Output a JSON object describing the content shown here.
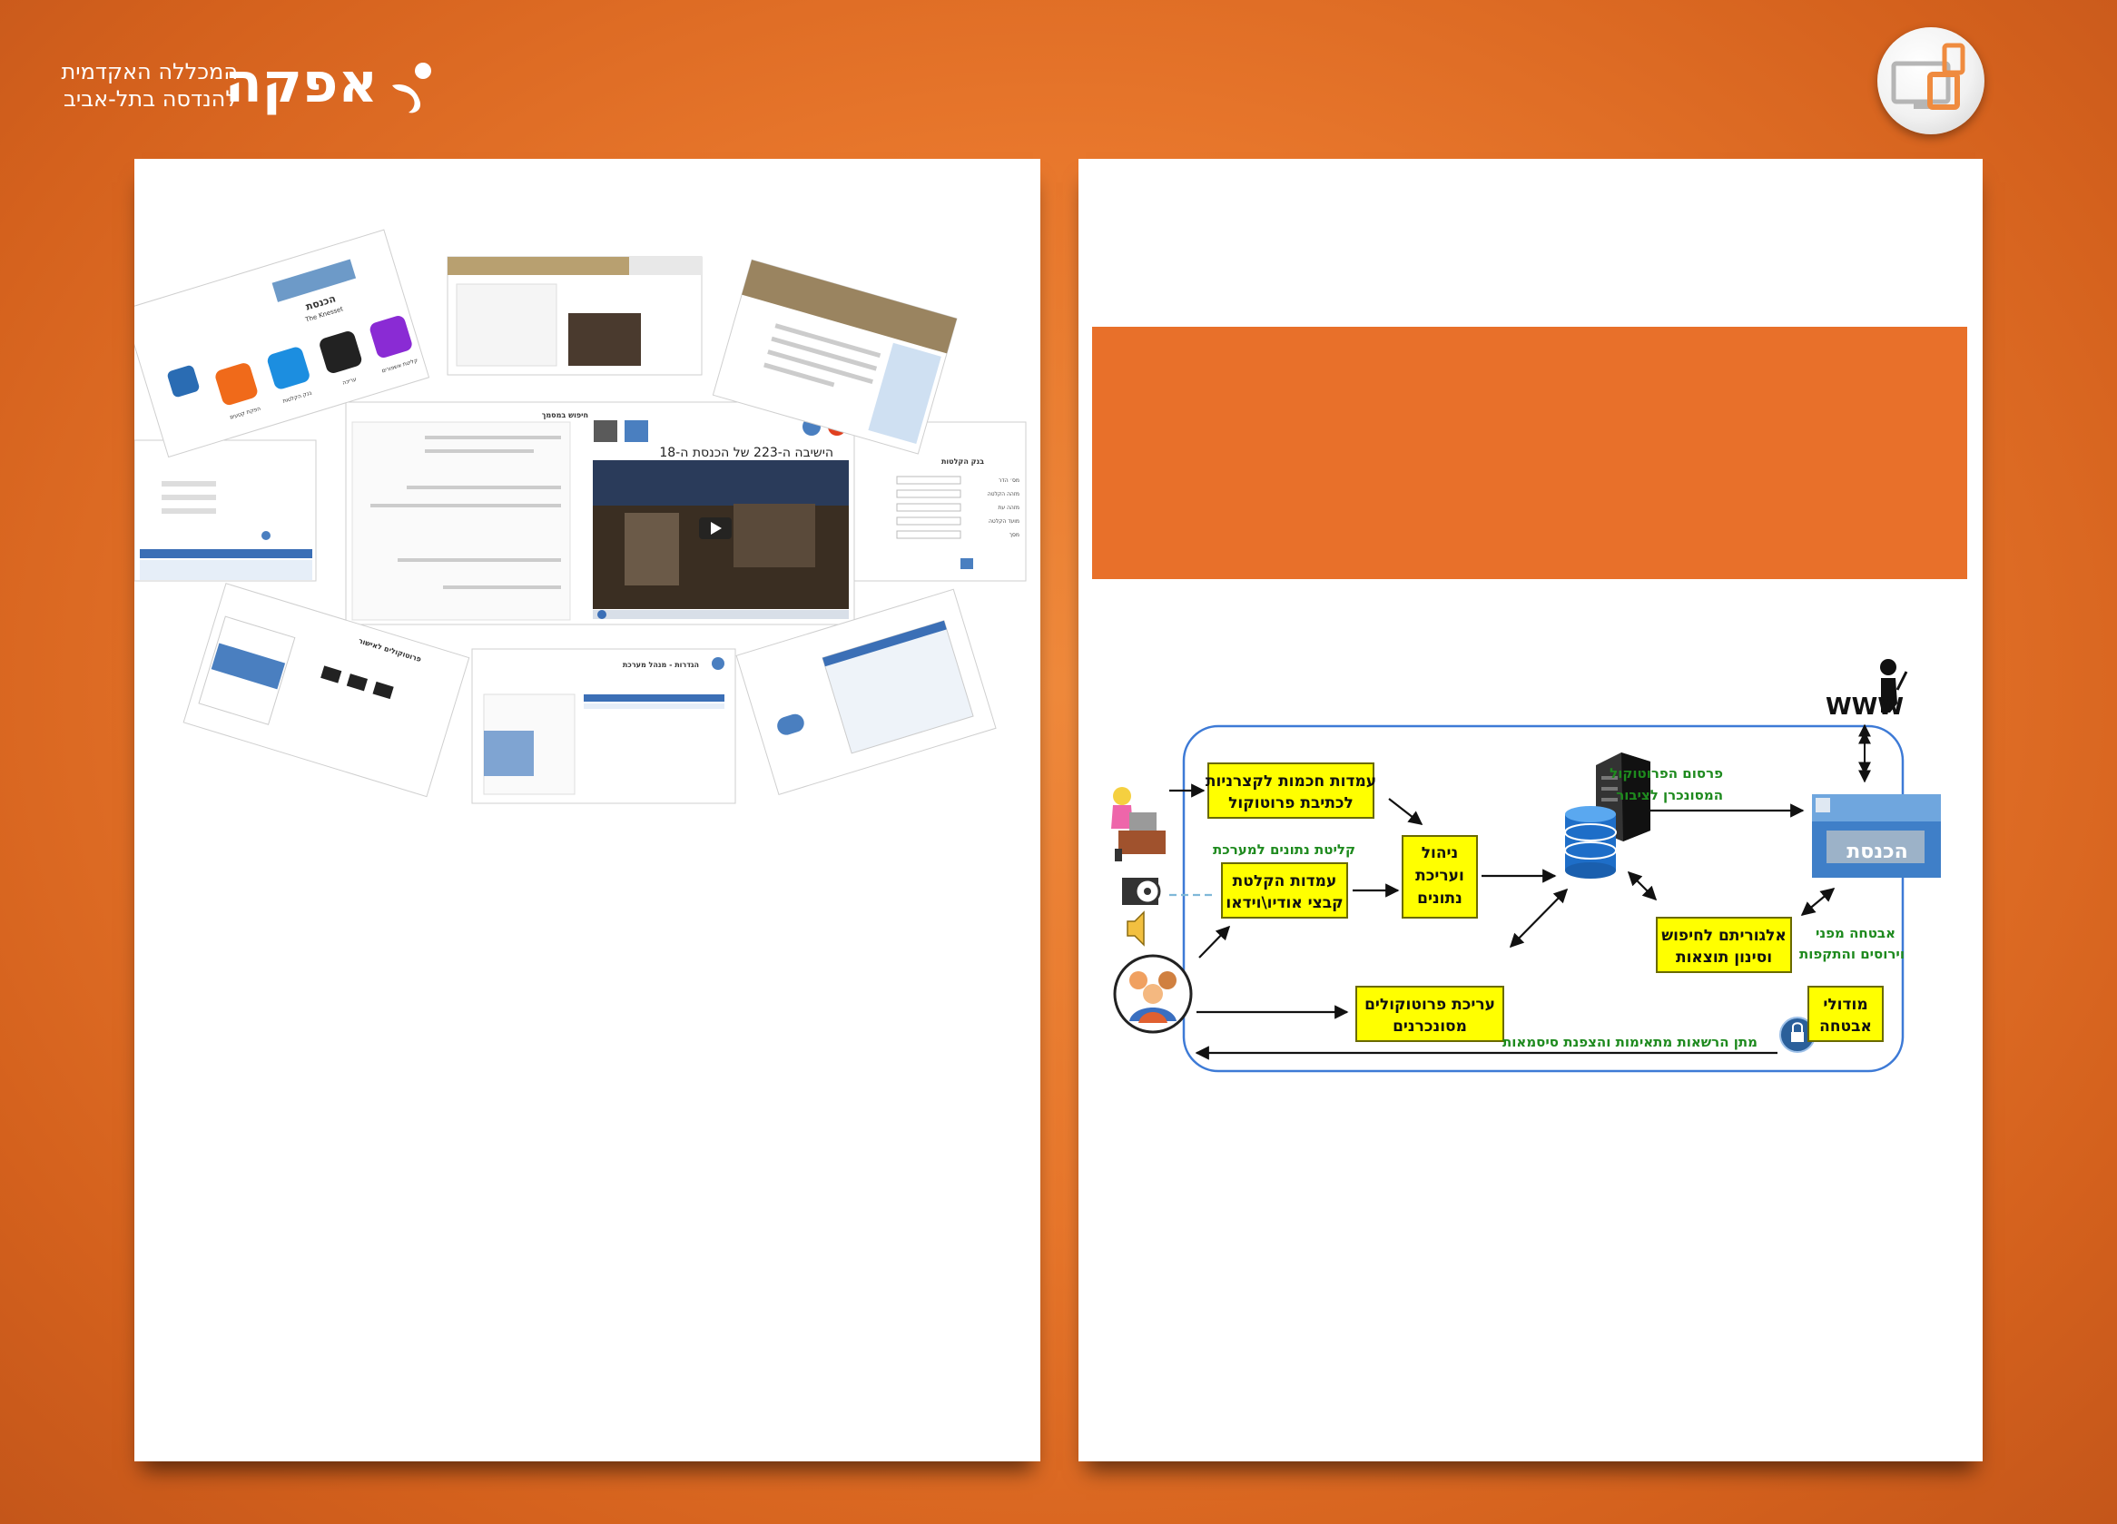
{
  "logo": {
    "name": "אפקה",
    "subtitle_line1": "המכללה האקדמית",
    "subtitle_line2": "להנדסה בתל-אביב"
  },
  "collage": {
    "video_title": "הישיבה ה-223 של הכנסת ה-18",
    "portal_title": "הכנסת",
    "portal_title_en": "The Knesset",
    "app_labels": [
      "קליטת אשפורים",
      "עריכה",
      "בנק הקלטות",
      "הפקת קטעים",
      "סיכום"
    ],
    "search_title": "חיפוש במסמך",
    "bank_title": "בנק הקלטות",
    "bank_fields": [
      "מס׳ הדר",
      "מזהה הקלטה",
      "מזהה עת",
      "מועד הקלטה",
      "מסך"
    ],
    "settings_title": "הגדרות - מנהל מערכת",
    "protocols_title": "פרוטוקולים לאישור"
  },
  "diagram": {
    "box_workstations": [
      "עמדות חכמות לקצרניות",
      "לכתיבת פרוטוקול"
    ],
    "box_recording": [
      "עמדות הקלטת",
      "קבצי אודיו\\וידאו"
    ],
    "box_management": [
      "ניהול",
      "ועריכת",
      "נתונים"
    ],
    "box_editing": [
      "עריכת פרוטוקולים",
      "מסונכרנים"
    ],
    "box_algorithm": [
      "אלגוריתם לחיפוש",
      "וסינון תוצאות"
    ],
    "box_security": [
      "מודולי",
      "אבטחה"
    ],
    "label_intake": "קליטת נתונים למערכת",
    "label_publish": [
      "פרסום הפרוטוקול",
      "המסונכרן לציבור"
    ],
    "label_protection": [
      "אבטחה מפני",
      "וירוסים והתקפות"
    ],
    "label_permissions": "מתן הרשאות מתאימות והצפנת סיסמאות",
    "label_www": "WWW",
    "portal_label": "הכנסת",
    "colors": {
      "box_fill": "#ffff00",
      "box_border": "#6a6a00",
      "green_text": "#1e8a1e",
      "frame": "#3d7ad6"
    }
  }
}
